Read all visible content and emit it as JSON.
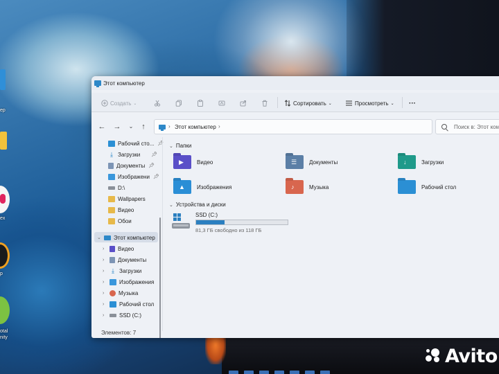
{
  "desktop": {
    "icon_labels": [
      "ер",
      "ex",
      "p",
      "otal\nnity"
    ]
  },
  "window": {
    "title": "Этот компьютер",
    "toolbar": {
      "create": "Создать",
      "sort": "Сортировать",
      "view": "Просмотреть",
      "more": "···"
    },
    "address": {
      "path": "Этот компьютер",
      "search_placeholder": "Поиск в: Этот компь"
    },
    "sidebar": {
      "quick_access": [
        {
          "label": "Рабочий сто...",
          "icon": "desktop-icon",
          "pinned": true
        },
        {
          "label": "Загрузки",
          "icon": "download-icon",
          "pinned": true
        },
        {
          "label": "Документы",
          "icon": "documents-icon",
          "pinned": true
        },
        {
          "label": "Изображени",
          "icon": "pictures-icon",
          "pinned": true
        },
        {
          "label": "D:\\",
          "icon": "drive-icon",
          "pinned": false
        },
        {
          "label": "Wallpapers",
          "icon": "folder-icon",
          "pinned": false
        },
        {
          "label": "Видео",
          "icon": "folder-icon",
          "pinned": false
        },
        {
          "label": "Обои",
          "icon": "folder-icon",
          "pinned": false
        }
      ],
      "this_pc": "Этот компьютер",
      "this_pc_children": [
        {
          "label": "Видео",
          "icon": "videos-icon"
        },
        {
          "label": "Документы",
          "icon": "documents-icon"
        },
        {
          "label": "Загрузки",
          "icon": "download-icon"
        },
        {
          "label": "Изображения",
          "icon": "pictures-icon"
        },
        {
          "label": "Музыка",
          "icon": "music-icon"
        },
        {
          "label": "Рабочий стол",
          "icon": "desktop-icon"
        },
        {
          "label": "SSD (C:)",
          "icon": "drive-icon"
        }
      ]
    },
    "content": {
      "folders_header": "Папки",
      "folders": [
        {
          "label": "Видео",
          "icon": "videos-folder-icon",
          "color": "#5a4fc8"
        },
        {
          "label": "Документы",
          "icon": "documents-folder-icon",
          "color": "#5b7fa6"
        },
        {
          "label": "Загрузки",
          "icon": "downloads-folder-icon",
          "color": "#1f9a8a"
        },
        {
          "label": "Изображения",
          "icon": "pictures-folder-icon",
          "color": "#2a8ed6"
        },
        {
          "label": "Музыка",
          "icon": "music-folder-icon",
          "color": "#d8664e"
        },
        {
          "label": "Рабочий стол",
          "icon": "desktop-folder-icon",
          "color": "#2b8fd4"
        }
      ],
      "drives_header": "Устройства и диски",
      "drive": {
        "name": "SSD (C:)",
        "free_text": "81,3 ГБ свободно из 118 ГБ",
        "used_fraction": 0.31
      }
    },
    "status": "Элементов: 7"
  },
  "watermark": "Avito",
  "colors": {
    "accent": "#2b7fc0",
    "window_bg": "#eef1f6",
    "selection": "#d6dde8"
  }
}
